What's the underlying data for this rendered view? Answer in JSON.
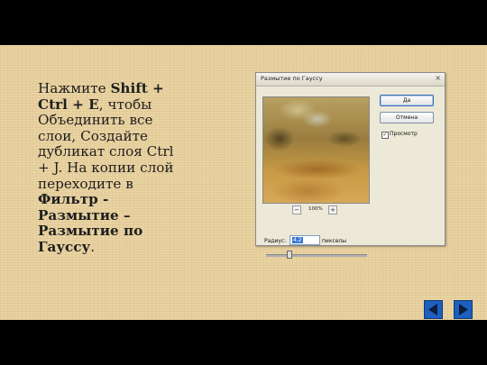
{
  "slide": {
    "text_parts": [
      {
        "t": "Нажмите ",
        "b": false
      },
      {
        "t": "Shift + Ctrl + E",
        "b": true
      },
      {
        "t": ", чтобы Объединить все слои, Создайте дубликат слоя Ctrl + J. На копии слой переходите в ",
        "b": false
      },
      {
        "t": "Фильтр - Размытие – Размытие по Гауссу",
        "b": true
      },
      {
        "t": ".",
        "b": false
      }
    ]
  },
  "dialog": {
    "title": "Размытие по Гауссу",
    "ok_label": "Да",
    "cancel_label": "Отмена",
    "preview_label": "Просмотр",
    "preview_checked": true,
    "zoom_level": "100%",
    "zoom_minus": "−",
    "zoom_plus": "+",
    "radius_label": "Радиус:",
    "radius_value": "4,2",
    "radius_unit": "пикселы"
  },
  "nav": {
    "prev_icon": "left-arrow-icon",
    "next_icon": "right-arrow-icon",
    "color": "#1c5fbf"
  }
}
